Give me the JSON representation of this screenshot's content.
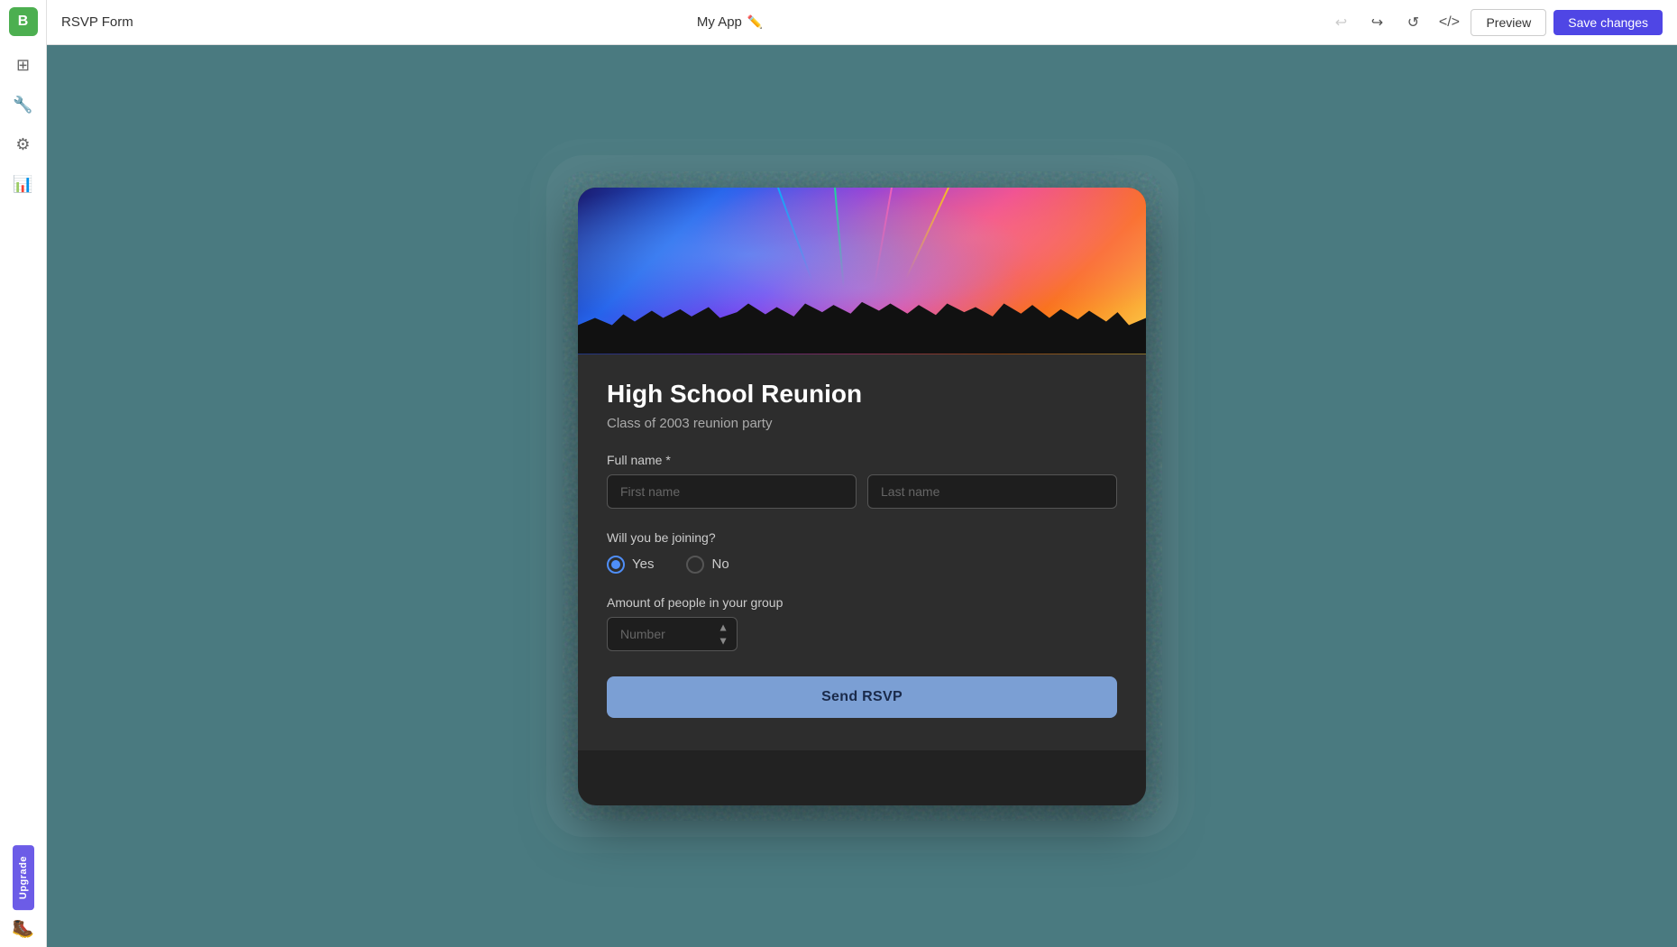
{
  "topbar": {
    "logo_text": "B",
    "page_title": "RSVP Form",
    "app_name": "My App",
    "edit_icon": "✏",
    "undo_icon": "↩",
    "redo_icon": "↪",
    "restore_icon": "↺",
    "code_icon": "</>",
    "preview_label": "Preview",
    "save_label": "Save changes"
  },
  "sidebar": {
    "items": [
      {
        "icon": "⊞",
        "name": "grid-icon"
      },
      {
        "icon": "🔧",
        "name": "tools-icon"
      },
      {
        "icon": "⚙",
        "name": "settings-icon"
      },
      {
        "icon": "📊",
        "name": "analytics-icon"
      }
    ],
    "upgrade_label": "Upgrade",
    "boot_icon": "🥾"
  },
  "form": {
    "title": "High School Reunion",
    "subtitle": "Class of 2003 reunion party",
    "full_name_label": "Full name *",
    "first_name_placeholder": "First name",
    "last_name_placeholder": "Last name",
    "joining_label": "Will you be joining?",
    "yes_label": "Yes",
    "no_label": "No",
    "group_label": "Amount of people in your group",
    "number_placeholder": "Number",
    "send_label": "Send RSVP"
  }
}
